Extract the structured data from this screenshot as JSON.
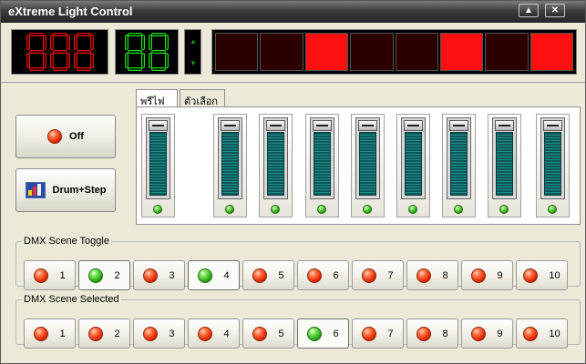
{
  "window": {
    "title": "eXtreme Light Control"
  },
  "titlebar_buttons": {
    "minimize": "▲",
    "close": "✕"
  },
  "digits_red": [
    [
      "a",
      "b",
      "c",
      "d",
      "e",
      "f",
      "g"
    ],
    [
      "a",
      "b",
      "c",
      "d",
      "e",
      "f",
      "g"
    ],
    [
      "a",
      "b",
      "c",
      "d",
      "e",
      "f",
      "g"
    ]
  ],
  "digits_green": [
    [
      "a",
      "b",
      "c",
      "d",
      "e",
      "f",
      "g"
    ],
    [
      "a",
      "b",
      "c",
      "d",
      "e",
      "f",
      "g"
    ]
  ],
  "spinner": {
    "up": "▲",
    "down": "▼"
  },
  "lamps": [
    false,
    false,
    true,
    false,
    false,
    true,
    false,
    true
  ],
  "buttons": {
    "off_label": "Off",
    "drum_label": "Drum+Step"
  },
  "tabs": [
    {
      "label": "พรีไฟ",
      "active": true
    },
    {
      "label": "ตัวเลือก",
      "active": false
    }
  ],
  "faders": [
    0,
    0,
    0,
    0,
    0,
    0,
    0,
    0,
    0
  ],
  "scene_toggle": {
    "legend": "DMX Scene Toggle",
    "items": [
      {
        "label": "1",
        "active": false
      },
      {
        "label": "2",
        "active": true
      },
      {
        "label": "3",
        "active": false
      },
      {
        "label": "4",
        "active": true
      },
      {
        "label": "5",
        "active": false
      },
      {
        "label": "6",
        "active": false
      },
      {
        "label": "7",
        "active": false
      },
      {
        "label": "8",
        "active": false
      },
      {
        "label": "9",
        "active": false
      },
      {
        "label": "10",
        "active": false
      }
    ]
  },
  "scene_selected": {
    "legend": "DMX Scene Selected",
    "items": [
      {
        "label": "1",
        "active": false
      },
      {
        "label": "2",
        "active": false
      },
      {
        "label": "3",
        "active": false
      },
      {
        "label": "4",
        "active": false
      },
      {
        "label": "5",
        "active": false
      },
      {
        "label": "6",
        "active": true
      },
      {
        "label": "7",
        "active": false
      },
      {
        "label": "8",
        "active": false
      },
      {
        "label": "9",
        "active": false
      },
      {
        "label": "10",
        "active": false
      }
    ]
  },
  "colors": {
    "lamp_on": "#ff1010",
    "lamp_off": "#2c0000",
    "led_red": "#e02000",
    "led_green": "#20a010",
    "fader_bar": "#1d8a8a"
  }
}
